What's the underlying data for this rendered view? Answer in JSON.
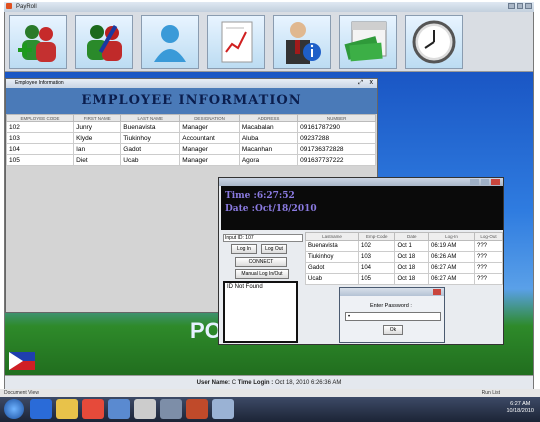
{
  "app": {
    "title": "PayRoll",
    "close": "x"
  },
  "employee": {
    "window_title": "Employee Information",
    "heading": "EMPLOYEE INFORMATION",
    "columns": [
      "EMPLOYEE CODE",
      "FIRST NAME",
      "LAST NAME",
      "DESIGNATION",
      "ADDRESS",
      "NUMBER"
    ],
    "rows": [
      [
        "102",
        "Junry",
        "Buenavista",
        "Manager",
        "Macabalan",
        "09161787290"
      ],
      [
        "103",
        "Klyde",
        "Tiukinhoy",
        "Accountant",
        "Aluba",
        "09237288"
      ],
      [
        "104",
        "Ian",
        "Gadot",
        "Manager",
        "Macanhan",
        "091736372828"
      ],
      [
        "105",
        "Diet",
        "Ucab",
        "Manager",
        "Agora",
        "091637737222"
      ]
    ]
  },
  "login": {
    "time": "Time :6:27:52",
    "date": "Date :Oct/18/2010",
    "input_label": "Input ID",
    "input_value": "107",
    "login_btn": "Log In",
    "logout_btn": "Log Out",
    "connect_btn": "CONNECT",
    "manual_btn": "Manual Log In/Out",
    "not_found": "ID Not Found",
    "columns": [
      "Lastname",
      "Emp-Code",
      "Date",
      "Log-In",
      "Log-Out"
    ],
    "rows": [
      [
        "Buenavista",
        "102",
        "Oct 1",
        "06:19 AM",
        "???"
      ],
      [
        "Tiukinhoy",
        "103",
        "Oct 18",
        "06:26 AM",
        "???"
      ],
      [
        "Gadot",
        "104",
        "Oct 18",
        "06:27 AM",
        "???"
      ],
      [
        "Ucab",
        "105",
        "Oct 18",
        "06:27 AM",
        "???"
      ]
    ]
  },
  "password": {
    "label": "Enter Password :",
    "value": "•",
    "ok": "Ok"
  },
  "banner": "PO",
  "status": {
    "user": "User Name:",
    "user_value": "C",
    "time_label": "Time Login :",
    "time_value": "Oct 18, 2010 6:26:36 AM"
  },
  "doc": {
    "left": "Document View",
    "right": "Run List"
  },
  "tray": {
    "time": "6:27 AM",
    "date": "10/18/2010"
  }
}
